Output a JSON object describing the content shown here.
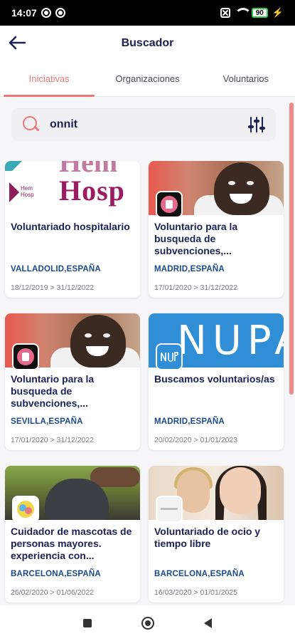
{
  "status_bar": {
    "time": "14:07",
    "battery": "90"
  },
  "header": {
    "title": "Buscador"
  },
  "tabs": [
    {
      "label": "Iniciativas",
      "active": true
    },
    {
      "label": "Organizaciones",
      "active": false
    },
    {
      "label": "Voluntarios",
      "active": false
    }
  ],
  "search": {
    "value": "onnit",
    "placeholder": ""
  },
  "cards": [
    {
      "title": "Voluntariado hospitalario",
      "location": "VALLADOLID,ESPAÑA",
      "dates": "18/12/2019 > 31/12/2022",
      "image_text": "Hosp",
      "image_text_top": "Hem",
      "logo_text": "Hem Hosp"
    },
    {
      "title": "Voluntario para la busqueda de subvenciones,...",
      "location": "MADRID,ESPAÑA",
      "dates": "17/01/2020 > 31/12/2022"
    },
    {
      "title": "Voluntario para la busqueda de subvenciones,...",
      "location": "SEVILLA,ESPAÑA",
      "dates": "17/01/2020 > 31/12/2022"
    },
    {
      "title": "Buscamos voluntarios/as",
      "location": "MADRID,ESPAÑA",
      "dates": "20/02/2020 > 01/01/2023",
      "image_text": "NUPA"
    },
    {
      "title": "Cuidador de mascotas de personas mayores. experiencia con...",
      "location": "BARCELONA,ESPAÑA",
      "dates": "26/02/2020 > 01/06/2022"
    },
    {
      "title": "Voluntariado de ocio y tiempo libre",
      "location": "BARCELONA,ESPAÑA",
      "dates": "16/03/2020 > 01/01/2025"
    }
  ],
  "colors": {
    "accent": "#e8797a",
    "navy": "#1a2256",
    "location_blue": "#1a4a8a"
  }
}
